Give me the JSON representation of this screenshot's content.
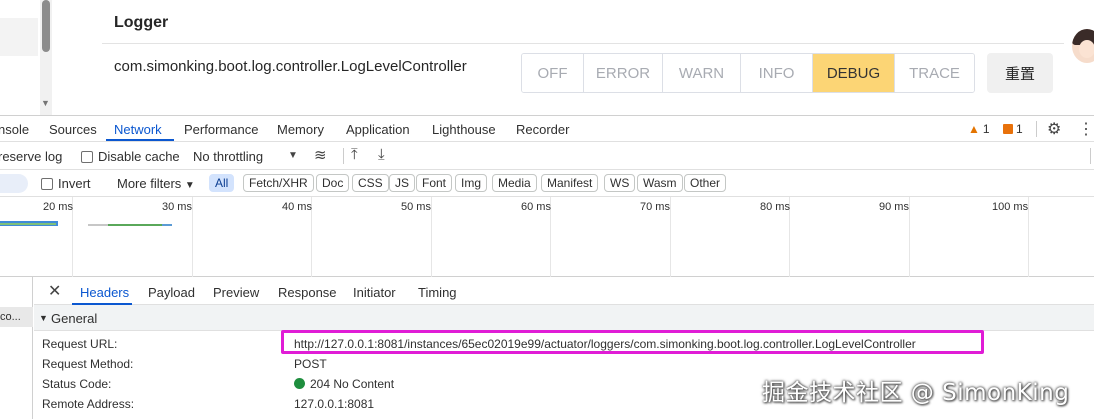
{
  "app": {
    "section_title": "Logger",
    "class_name": "com.simonking.boot.log.controller.LogLevelController",
    "levels": [
      "OFF",
      "ERROR",
      "WARN",
      "INFO",
      "DEBUG",
      "TRACE"
    ],
    "active_level": "DEBUG",
    "reset_label": "重置"
  },
  "devtools": {
    "tabs": [
      "nsole",
      "Sources",
      "Network",
      "Performance",
      "Memory",
      "Application",
      "Lighthouse",
      "Recorder"
    ],
    "active_tab": "Network",
    "warnings_count": "1",
    "issues_count": "1",
    "toolbar": {
      "preserve_log": "reserve log",
      "disable_cache": "Disable cache",
      "throttling": "No throttling"
    },
    "filter": {
      "invert": "Invert",
      "more_filters": "More filters",
      "types": [
        "All",
        "Fetch/XHR",
        "Doc",
        "CSS",
        "JS",
        "Font",
        "Img",
        "Media",
        "Manifest",
        "WS",
        "Wasm",
        "Other"
      ],
      "active_type": "All"
    },
    "timeline_ticks": [
      "20 ms",
      "30 ms",
      "40 ms",
      "50 ms",
      "60 ms",
      "70 ms",
      "80 ms",
      "90 ms",
      "100 ms"
    ],
    "request_list_item": "co...",
    "detail_tabs": [
      "Headers",
      "Payload",
      "Preview",
      "Response",
      "Initiator",
      "Timing"
    ],
    "active_detail_tab": "Headers",
    "general_section": "General",
    "general": {
      "request_url_label": "Request URL:",
      "request_url": "http://127.0.0.1:8081/instances/65ec02019e99/actuator/loggers/com.simonking.boot.log.controller.LogLevelController",
      "method_label": "Request Method:",
      "method": "POST",
      "status_label": "Status Code:",
      "status": "204 No Content",
      "remote_label": "Remote Address:",
      "remote": "127.0.0.1:8081"
    }
  },
  "watermark": "掘金技术社区 @ SimonKing",
  "colors": {
    "active_level_bg": "#fcd575",
    "devtools_accent": "#0b57d0",
    "url_highlight": "#e01cd6",
    "status_ok": "#1e8e3e"
  }
}
